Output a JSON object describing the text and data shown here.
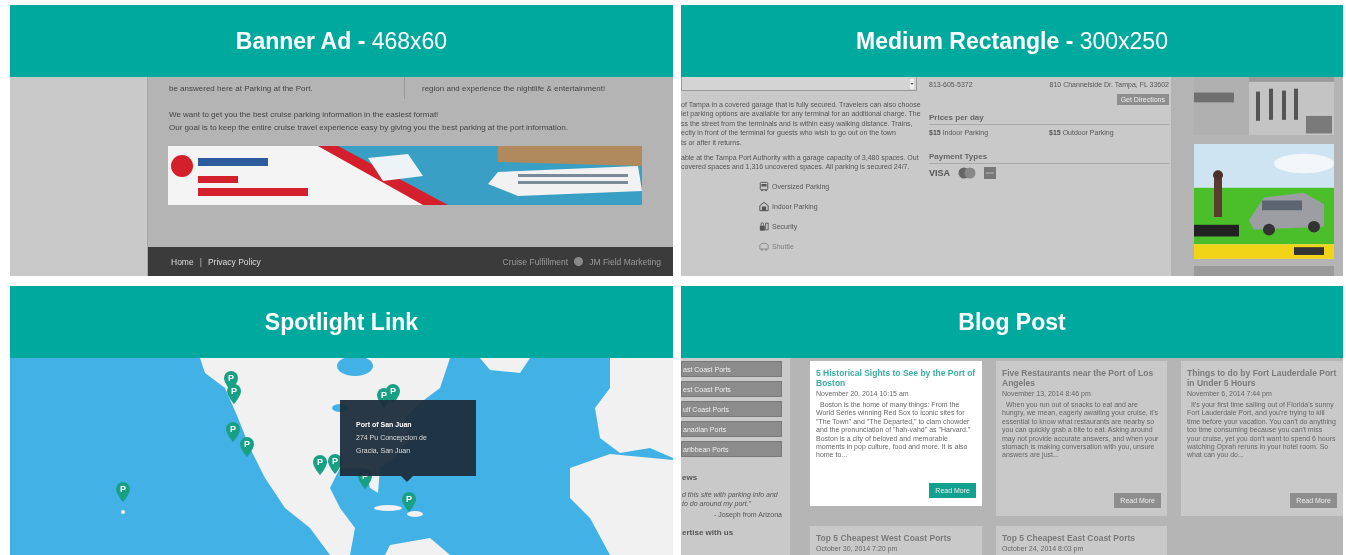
{
  "banner_ad": {
    "header": "**Banner Ad -** 468x60",
    "intro_left": "be answered here at Parking at the Port.",
    "intro_right": "region and experience the nightlife & entertainment!",
    "paragraph_lines": [
      "We want to get you the best cruise parking information in the easiest format!",
      "Our goal is to keep the entire cruise travel experience easy by giving you the best parking at the port information."
    ],
    "footer_links": [
      "Home",
      "Privacy Policy"
    ],
    "footer_separator": "|",
    "credit_left": "Cruise Fulfillment",
    "credit_right": "JM Field Marketing"
  },
  "medium_rectangle": {
    "header": "**Medium Rectangle -** 300x250",
    "description_paragraphs": [
      [
        "of Tampa in a covered garage that is fully secured. Travelers can also choose",
        "let parking options are available for any terminal for an additional charge. The",
        "ss the street from the terminals and is within easy walking distance. Trains,",
        "ectly in front of the terminal for guests who wish to go out on the town",
        "ts or after it returns."
      ],
      [
        "able at the Tampa Port Authority with a garage capacity of 3,480 spaces. Out",
        "covered spaces and 1,316 uncovered spaces. All parking is secured 24/7."
      ]
    ],
    "amenities": [
      {
        "kind": "bus",
        "label": "Oversized Parking",
        "disabled": false
      },
      {
        "kind": "garage",
        "label": "Indoor Parking",
        "disabled": false
      },
      {
        "kind": "security",
        "label": "Security",
        "disabled": false
      },
      {
        "kind": "shuttle",
        "label": "Shuttle",
        "disabled": true
      }
    ],
    "phone": "813-605-5372",
    "address": "810 Channelside Dr. Tampa, FL 33602",
    "directions_button": "Get Directions",
    "prices_heading": "Prices per day",
    "prices": [
      {
        "amount": "$15",
        "label": "Indoor Parking"
      },
      {
        "amount": "$15",
        "label": "Outdoor Parking"
      }
    ],
    "payment_heading": "Payment Types",
    "payment_methods": [
      {
        "kind": "text",
        "label": "VISA"
      },
      {
        "kind": "circles"
      },
      {
        "kind": "card"
      }
    ]
  },
  "spotlight_link": {
    "header": "Spotlight Link",
    "markers": [
      {
        "label": "P"
      },
      {
        "label": "P"
      },
      {
        "label": "P"
      },
      {
        "label": "P"
      },
      {
        "label": "P"
      },
      {
        "label": "P"
      },
      {
        "label": "P"
      },
      {
        "label": "P"
      },
      {
        "label": "P"
      },
      {
        "label": "P"
      },
      {
        "label": "P"
      }
    ],
    "tooltip": {
      "title": "Port of San Juan",
      "address_lines": [
        "274 Pu Concepcion de",
        "Gracia, San Juan"
      ]
    }
  },
  "blog_post": {
    "header": "Blog Post",
    "sidebar_buttons": [
      "ast Coast Ports",
      "est Coast Ports",
      "ulf Coast Ports",
      "anadian Ports",
      "aribbean Ports"
    ],
    "reviews_heading": "ews",
    "review_lines": [
      "d this site with parking info and",
      "to do around my port.\""
    ],
    "review_author": "- Joseph from Arizona",
    "advertise_heading": "ertise with us",
    "posts": [
      {
        "title": "5 Historical Sights to See by the Port of Boston",
        "date": "November 20, 2014 10:15 am",
        "excerpt": "Boston is the home of many things: From the World Series winning Red Sox to iconic sites for \"The Town\" and \"The Departed,\" to clam chowder and the pronunciation of \"hah-vahd\" as \"Harvard.\" Boston is a city of beloved and memorable moments in pop culture, food and more. It is also home to...",
        "button": "Read More",
        "highlighted": true
      },
      {
        "title": "Five Restaurants near the Port of Los Angeles",
        "date": "November 13, 2014 8:46 pm",
        "excerpt": "When you run out of snacks to eat and are hungry, we mean, eagerly awaiting your cruise, it's essential to know what restaurants are nearby so you can quickly grab a bite to eat. Asking around may not provide accurate answers, and when your stomach is making conversation with you, unsure answers are just...",
        "button": "Read More",
        "highlighted": false
      },
      {
        "title": "Things to do by Fort Lauderdale Port in Under 5 Hours",
        "date": "November 6, 2014 7:44 pm",
        "excerpt": "It's your first time sailing out of Florida's sunny Fort Lauderdale Port, and you're trying to kill time before your vacation. You can't do anything too time consuming because you can't miss your cruise, yet you don't want to spend 6 hours watching Oprah reruns in your hotel room. So what can you do...",
        "button": "Read More",
        "highlighted": false
      },
      {
        "title": "Top 5 Cheapest West Coast Ports",
        "date": "October 30, 2014 7:20 pm",
        "highlighted": false
      },
      {
        "title": "Top 5 Cheapest East Coast Ports",
        "date": "October 24, 2014 8:03 pm",
        "highlighted": false
      }
    ]
  }
}
